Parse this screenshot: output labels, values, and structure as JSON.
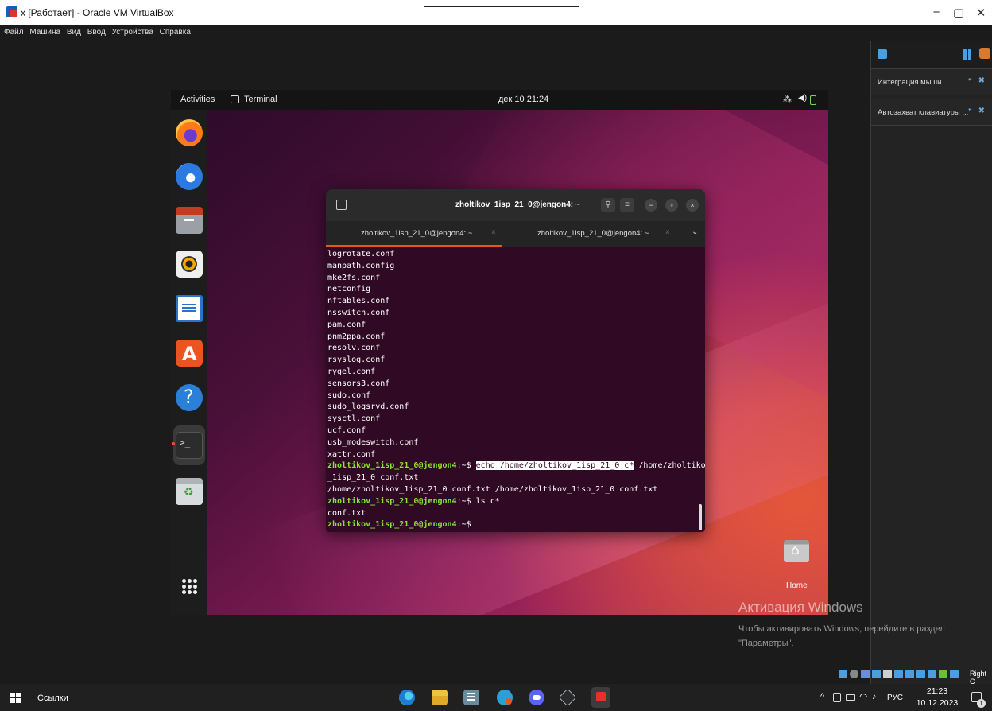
{
  "vbox": {
    "title": "x [Работает] - Oracle VM VirtualBox",
    "menu": [
      "Файл",
      "Машина",
      "Вид",
      "Ввод",
      "Устройства",
      "Справка"
    ],
    "window_controls": {
      "minimize": "−",
      "maximize": "▢",
      "close": "✕"
    }
  },
  "side_panel": {
    "items": [
      {
        "label": "Интеграция мыши ..."
      },
      {
        "label": "Автозахват клавиатуры ..."
      }
    ]
  },
  "ubuntu": {
    "activities": "Activities",
    "app_name": "Terminal",
    "clock": "дек 10 21:24",
    "tray": {
      "network": "⁂",
      "volume": "◀)"
    },
    "home_label": "Home",
    "dock": [
      "firefox-icon",
      "thunderbird-icon",
      "files-icon",
      "rhythmbox-icon",
      "writer-icon",
      "app-center-icon",
      "help-icon",
      "terminal-icon",
      "trash-icon",
      "show-apps-icon"
    ]
  },
  "terminal": {
    "title": "zholtikov_1isp_21_0@jengon4: ~",
    "tabs": [
      {
        "label": "zholtikov_1isp_21_0@jengon4: ~"
      },
      {
        "label": "zholtikov_1isp_21_0@jengon4: ~"
      }
    ],
    "lines": [
      {
        "text": "logrotate.conf"
      },
      {
        "text": "manpath.config"
      },
      {
        "text": "mke2fs.conf"
      },
      {
        "text": "netconfig"
      },
      {
        "text": "nftables.conf"
      },
      {
        "text": "nsswitch.conf"
      },
      {
        "text": "pam.conf"
      },
      {
        "text": "pnm2ppa.conf"
      },
      {
        "text": "resolv.conf"
      },
      {
        "text": "rsyslog.conf"
      },
      {
        "text": "rygel.conf"
      },
      {
        "text": "sensors3.conf"
      },
      {
        "text": "sudo.conf"
      },
      {
        "text": "sudo_logsrvd.conf"
      },
      {
        "text": "sysctl.conf"
      },
      {
        "text": "ucf.conf"
      },
      {
        "text": "usb_modeswitch.conf"
      },
      {
        "text": "xattr.conf"
      },
      {
        "prompt": "zholtikov_1isp_21_0@jengon4",
        "path": ":~$ ",
        "highlight": "echo /home/zholtikov_1isp_21_0 c*",
        "text": " /home/zholtikov"
      },
      {
        "text": "_1isp_21_0 conf.txt"
      },
      {
        "text": "/home/zholtikov_1isp_21_0 conf.txt /home/zholtikov_1isp_21_0 conf.txt"
      },
      {
        "prompt": "zholtikov_1isp_21_0@jengon4",
        "path": ":~$ ",
        "text": "ls c*"
      },
      {
        "text": "conf.txt"
      },
      {
        "prompt": "zholtikov_1isp_21_0@jengon4",
        "path": ":~$ ",
        "text": ""
      }
    ]
  },
  "windows": {
    "activate_title": "Активация Windows",
    "activate_sub": "Чтобы активировать Windows, перейдите в раздел \"Параметры\".",
    "vbox_host_key": "Right C",
    "taskbar": {
      "links": "Ссылки",
      "lang": "РУС",
      "time": "21:23",
      "date": "10.12.2023",
      "notifications": "1",
      "chevron": "^"
    }
  }
}
